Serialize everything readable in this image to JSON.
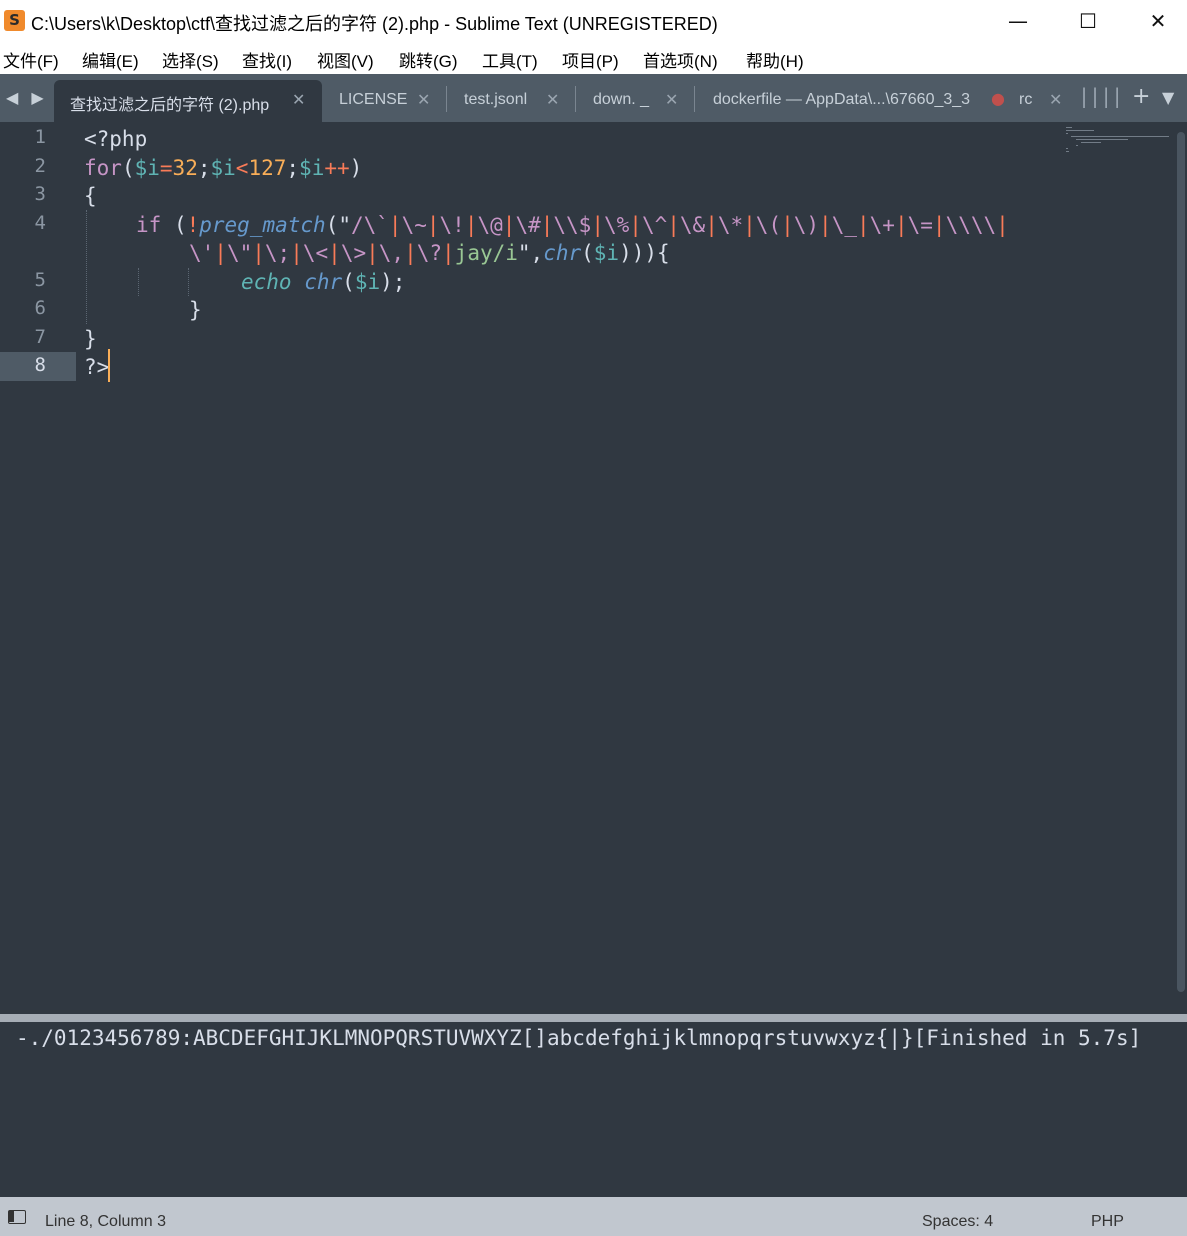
{
  "window": {
    "title": "C:\\Users\\k\\Desktop\\ctf\\查找过滤之后的字符 (2).php - Sublime Text (UNREGISTERED)",
    "app_icon_glyph": "S",
    "minimize": "—",
    "maximize": "☐",
    "close": "✕"
  },
  "menu": [
    "文件(F)",
    "编辑(E)",
    "选择(S)",
    "查找(I)",
    "视图(V)",
    "跳转(G)",
    "工具(T)",
    "项目(P)",
    "首选项(N)",
    "帮助(H)"
  ],
  "tabs": {
    "nav": "◀ ▶",
    "items": [
      {
        "label": "查找过滤之后的字符 (2).php",
        "active": true
      },
      {
        "label": "LICENSE"
      },
      {
        "label": "test.jsonl"
      },
      {
        "label": "down. _"
      },
      {
        "label": "dockerfile — AppData\\...\\67660_3_3",
        "dirty": true
      },
      {
        "label": "rc"
      }
    ],
    "close_glyph": "✕",
    "dirty_glyph": "●",
    "stack_glyph": "||||",
    "new_tab": "+",
    "more": "▼"
  },
  "editor": {
    "line_numbers": [
      "1",
      "2",
      "3",
      "4",
      "",
      "5",
      "6",
      "7",
      "8"
    ],
    "code": {
      "l1": "<?php",
      "l2": {
        "kw": "for",
        "p1": "(",
        "v1": "$i",
        "o1": "=",
        "n1": "32",
        "p2": ";",
        "v2": "$i",
        "o2": "<",
        "n2": "127",
        "p3": ";",
        "v3": "$i",
        "o3": "++",
        "p4": ")"
      },
      "l3": "{",
      "l4": {
        "kw": "if",
        "p1": " (",
        "not": "!",
        "fn": "preg_match",
        "p2": "(\"",
        "rx_start": "/\\`",
        "rx_a": [
          "\\~",
          "\\!",
          "\\@",
          "\\#",
          "\\\\$",
          "\\%",
          "\\^",
          "\\&",
          "\\*",
          "\\(",
          "\\)",
          "\\_",
          "\\+",
          "\\=",
          "\\\\\\\\"
        ]
      },
      "l4b": {
        "rx_b": [
          "\\'",
          "\\\"",
          "\\;",
          "\\<",
          "\\>",
          "\\,",
          "\\?"
        ],
        "tail": "jay/i",
        "p1": "\",",
        "fn": "chr",
        "p2": "(",
        "v": "$i",
        "p3": "))){"
      },
      "l5": {
        "kw": "echo",
        "fn": "chr",
        "p1": "(",
        "v": "$i",
        "p2": ");"
      },
      "l6": "}",
      "l7": "}",
      "l8": "?>"
    }
  },
  "output": {
    "text": "-./0123456789:ABCDEFGHIJKLMNOPQRSTUVWXYZ[]abcdefghijklmnopqrstuvwxyz{|}[Finished in 5.7s]"
  },
  "status": {
    "position": "Line 8, Column 3",
    "indent": "Spaces: 4",
    "syntax": "PHP"
  }
}
